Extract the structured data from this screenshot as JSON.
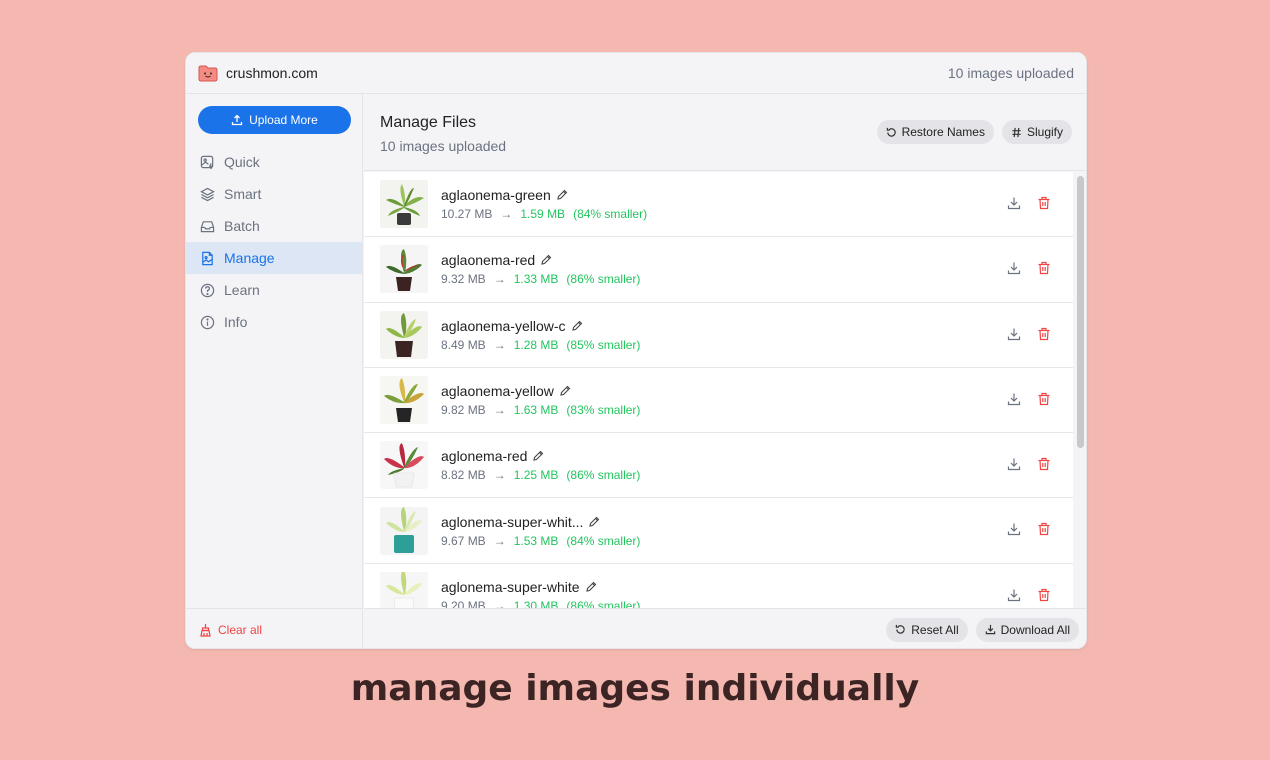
{
  "app": {
    "site_name": "crushmon.com",
    "uploaded_count_text": "10 images uploaded"
  },
  "sidebar": {
    "upload_label": "Upload More",
    "items": [
      {
        "label": "Quick",
        "icon": "image-bolt-icon"
      },
      {
        "label": "Smart",
        "icon": "layers-icon"
      },
      {
        "label": "Batch",
        "icon": "inbox-icon"
      },
      {
        "label": "Manage",
        "icon": "file-image-icon",
        "active": true
      },
      {
        "label": "Learn",
        "icon": "help-circle-icon"
      },
      {
        "label": "Info",
        "icon": "info-icon"
      }
    ],
    "clear_label": "Clear all"
  },
  "main": {
    "title": "Manage Files",
    "subtitle": "10 images uploaded",
    "restore_label": "Restore Names",
    "slugify_label": "Slugify",
    "files": [
      {
        "name": "aglaonema-green",
        "original": "10.27 MB",
        "compressed": "1.59 MB",
        "saving": "(84% smaller)"
      },
      {
        "name": "aglaonema-red",
        "original": "9.32 MB",
        "compressed": "1.33 MB",
        "saving": "(86% smaller)"
      },
      {
        "name": "aglaonema-yellow-c",
        "original": "8.49 MB",
        "compressed": "1.28 MB",
        "saving": "(85% smaller)"
      },
      {
        "name": "aglaonema-yellow",
        "original": "9.82 MB",
        "compressed": "1.63 MB",
        "saving": "(83% smaller)"
      },
      {
        "name": "aglonema-red",
        "original": "8.82 MB",
        "compressed": "1.25 MB",
        "saving": "(86% smaller)"
      },
      {
        "name": "aglonema-super-whit...",
        "original": "9.67 MB",
        "compressed": "1.53 MB",
        "saving": "(84% smaller)"
      },
      {
        "name": "aglonema-super-white",
        "original": "9.20 MB",
        "compressed": "1.30 MB",
        "saving": "(86% smaller)"
      }
    ],
    "arrow": "→",
    "reset_label": "Reset All",
    "download_all_label": "Download All"
  },
  "caption": "manage images individually",
  "colors": {
    "background": "#f4b8b0",
    "accent": "#1a73e8",
    "success": "#22c55e",
    "danger": "#ef4444"
  }
}
